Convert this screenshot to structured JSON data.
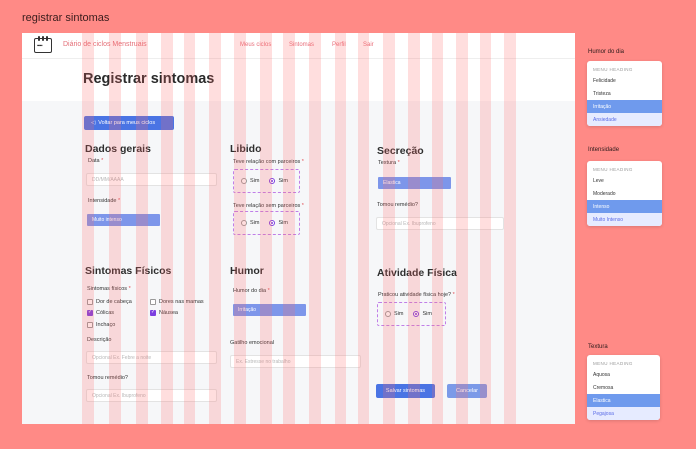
{
  "canvas": {
    "title": "registrar sintomas"
  },
  "app": {
    "name": "Diário de ciclos Menstruais",
    "nav": [
      "Meus ciclos",
      "Sintomas",
      "Perfil",
      "Sair"
    ]
  },
  "page": {
    "title": "Registrar sintomas",
    "back_label": "Voltar para meus ciclos"
  },
  "dados_gerais": {
    "title": "Dados gerais",
    "date_label": "Data",
    "date_placeholder": "DD/MM/AAAA",
    "intensity_label": "Intensidade",
    "intensity_value": "Muito intenso"
  },
  "libido": {
    "title": "Libido",
    "q1": "Teve relação com parceiros",
    "q2": "Teve relação sem parceiros",
    "opt_no": "Sim",
    "opt_yes": "Sim"
  },
  "secrecao": {
    "title": "Secreção",
    "texture_label": "Textura",
    "texture_value": "Elastica",
    "remedy_label": "Tomou remédio?",
    "remedy_placeholder": "Opcional Ex. Ibuprofeno"
  },
  "sintomas": {
    "title": "Sintomas Físicos",
    "label": "Sintomas físicos",
    "items": [
      {
        "label": "Dor de cabeça",
        "checked": false
      },
      {
        "label": "Dores nas mamas",
        "checked": false
      },
      {
        "label": "Cólicas",
        "checked": true
      },
      {
        "label": "Náusea",
        "checked": true
      },
      {
        "label": "Inchaço",
        "checked": false
      }
    ],
    "desc_label": "Descrição",
    "desc_placeholder": "Opcional Ex. Febre a noite",
    "remedy_label": "Tomou remédio?",
    "remedy_placeholder": "Opcional Ex. Ibuprofeno"
  },
  "humor": {
    "title": "Humor",
    "label": "Humor do dia",
    "value": "Irritação",
    "trigger_label": "Gatilho emocional",
    "trigger_placeholder": "Ex. Estresse no trabalho"
  },
  "atividade": {
    "title": "Atividade Física",
    "label": "Praticou atividade física hoje?",
    "opt_no": "Sim",
    "opt_yes": "Sim"
  },
  "actions": {
    "save": "Salvar sintomas",
    "cancel": "Cancelar"
  },
  "panels": {
    "humor": {
      "title": "Humor do dia",
      "heading": "MENU HEADING",
      "items": [
        "Felicidade",
        "Tristeza",
        "Irritação",
        "Ansiedade"
      ]
    },
    "intensidade": {
      "title": "Intensidade",
      "heading": "MENU HEADING",
      "items": [
        "Leve",
        "Moderado",
        "Intenso",
        "Muito Intenso"
      ]
    },
    "textura": {
      "title": "Textura",
      "heading": "MENU HEADING",
      "items": [
        "Aquosa",
        "Cremosa",
        "Elastica",
        "Pegajosa"
      ]
    }
  },
  "colors": {
    "background": "#ff8a86",
    "accent": "#4a74e4",
    "brand": "#e46f78",
    "selected": "#7b3fe0"
  }
}
